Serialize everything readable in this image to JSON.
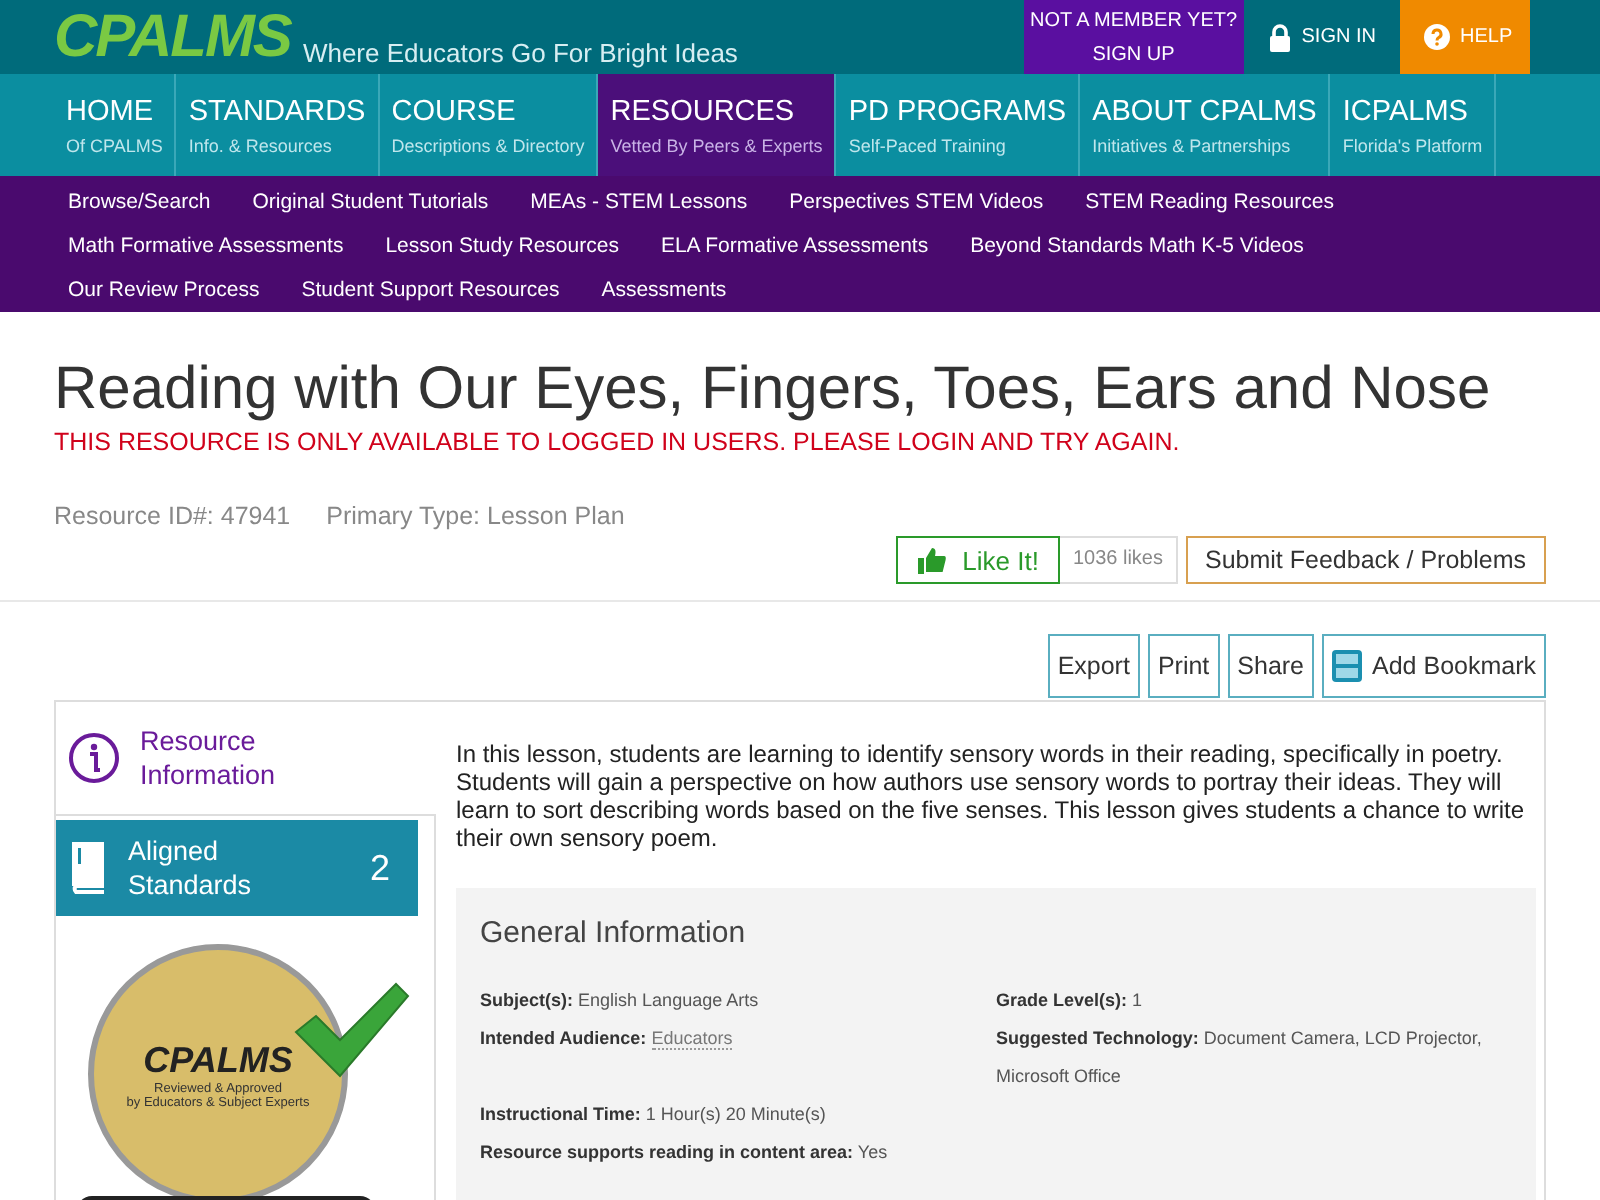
{
  "header": {
    "logo": "CPALMS",
    "tagline": "Where Educators Go For Bright Ideas",
    "signup": {
      "line1": "NOT A MEMBER YET?",
      "line2": "SIGN UP"
    },
    "signin": "SIGN IN",
    "help": "HELP"
  },
  "nav": [
    {
      "title": "HOME",
      "subtitle": "Of CPALMS",
      "selected": false
    },
    {
      "title": "STANDARDS",
      "subtitle": "Info. & Resources",
      "selected": false
    },
    {
      "title": "COURSE",
      "subtitle": "Descriptions & Directory",
      "selected": false
    },
    {
      "title": "RESOURCES",
      "subtitle": "Vetted By Peers & Experts",
      "selected": true
    },
    {
      "title": "PD PROGRAMS",
      "subtitle": "Self-Paced Training",
      "selected": false
    },
    {
      "title": "ABOUT CPALMS",
      "subtitle": "Initiatives & Partnerships",
      "selected": false
    },
    {
      "title": "ICPALMS",
      "subtitle": "Florida's Platform",
      "selected": false
    }
  ],
  "submenu": [
    [
      "Browse/Search",
      "Original Student Tutorials",
      "MEAs - STEM Lessons",
      "Perspectives STEM Videos",
      "STEM Reading Resources"
    ],
    [
      "Math Formative Assessments",
      "Lesson Study Resources",
      "ELA Formative Assessments",
      "Beyond Standards Math K-5 Videos"
    ],
    [
      "Our Review Process",
      "Student Support Resources",
      "Assessments"
    ]
  ],
  "title": "Reading with Our Eyes, Fingers, Toes, Ears and Nose",
  "notice": "THIS RESOURCE IS ONLY AVAILABLE TO LOGGED IN USERS. PLEASE LOGIN AND TRY AGAIN.",
  "meta": [
    "Resource ID#: 47941",
    "Primary Type: Lesson Plan"
  ],
  "like": {
    "label": "Like It!",
    "count": "1036 likes"
  },
  "feedback": "Submit Feedback / Problems",
  "actions": [
    {
      "label": "Export",
      "kind": "plain"
    },
    {
      "label": "Print",
      "kind": "plain"
    },
    {
      "label": "Share",
      "kind": "plain"
    },
    {
      "label": "Add Bookmark",
      "kind": "bookmark"
    }
  ],
  "sidebar": [
    {
      "kind": "info",
      "label": "Resource Information",
      "selected": true
    },
    {
      "kind": "standards",
      "label": "Aligned Standards",
      "count": "2",
      "selected": false
    }
  ],
  "badge": {
    "logo": "CPALMS",
    "line1": "Reviewed & Approved",
    "line2": "by Educators & Subject Experts"
  },
  "description": "In this lesson, students are learning to identify sensory words in their reading, specifically in poetry. Students will gain a perspective on how authors use sensory words to portray their ideas. They will learn to sort describing words based on the five senses. This lesson gives students a chance to write their own sensory poem.",
  "general": {
    "heading": "General Information",
    "left": [
      {
        "label": "Subject(s):",
        "value": "English Language Arts",
        "kind": "text"
      },
      {
        "label": "Intended Audience:",
        "value": "Educators",
        "kind": "link"
      },
      {
        "label": "Instructional Time:",
        "value": "1 Hour(s) 20 Minute(s)",
        "kind": "text"
      },
      {
        "label": "Resource supports reading in content area:",
        "value": "Yes",
        "kind": "text"
      }
    ],
    "right": [
      {
        "label": "Grade Level(s):",
        "value": "1",
        "kind": "text"
      },
      {
        "label": "Suggested Technology:",
        "value": "Document Camera, LCD Projector, Microsoft Office",
        "kind": "text"
      }
    ]
  }
}
